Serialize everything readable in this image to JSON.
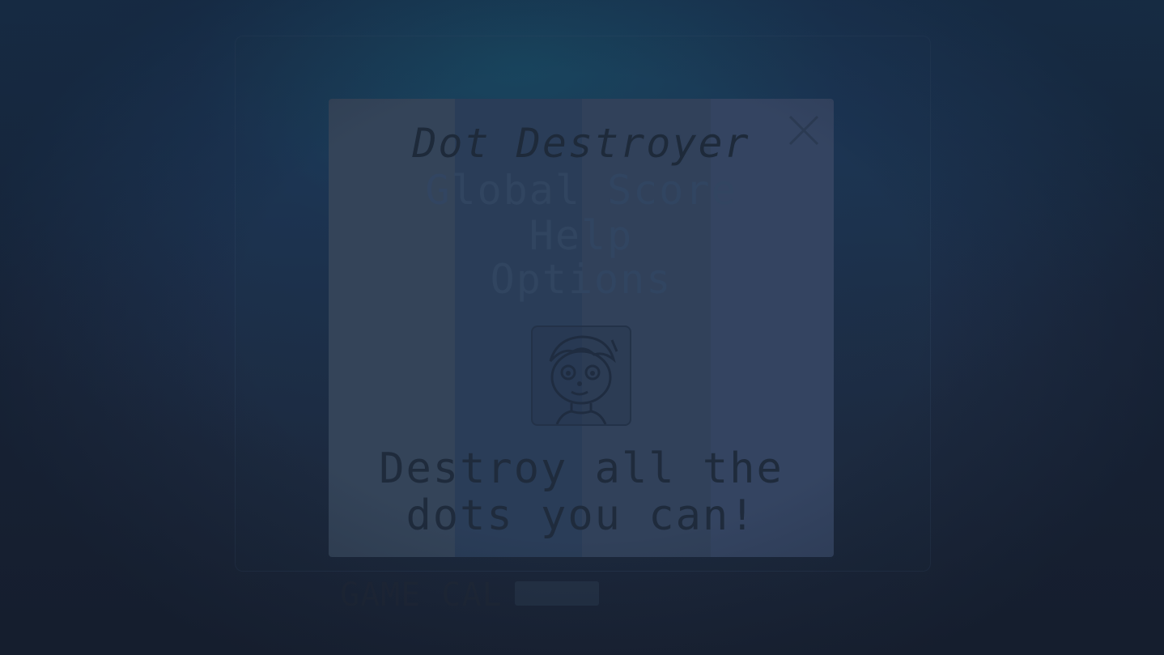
{
  "game": {
    "title": "Dot Destroyer",
    "menu": [
      {
        "label": "Global Score"
      },
      {
        "label": "Help"
      },
      {
        "label": "Options"
      }
    ],
    "tagline": "Destroy all the dots you can!",
    "close_icon": "close-icon",
    "mascot_icon": "mascot-face-icon"
  },
  "footer": {
    "label": "GAME CAL",
    "badge": ""
  },
  "colors": {
    "background": "#1b2537",
    "stripe_1": "#344459",
    "stripe_2": "#2a3d58",
    "stripe_3": "#31415a",
    "stripe_4": "#344461",
    "text_dark": "#1e2a3a"
  }
}
